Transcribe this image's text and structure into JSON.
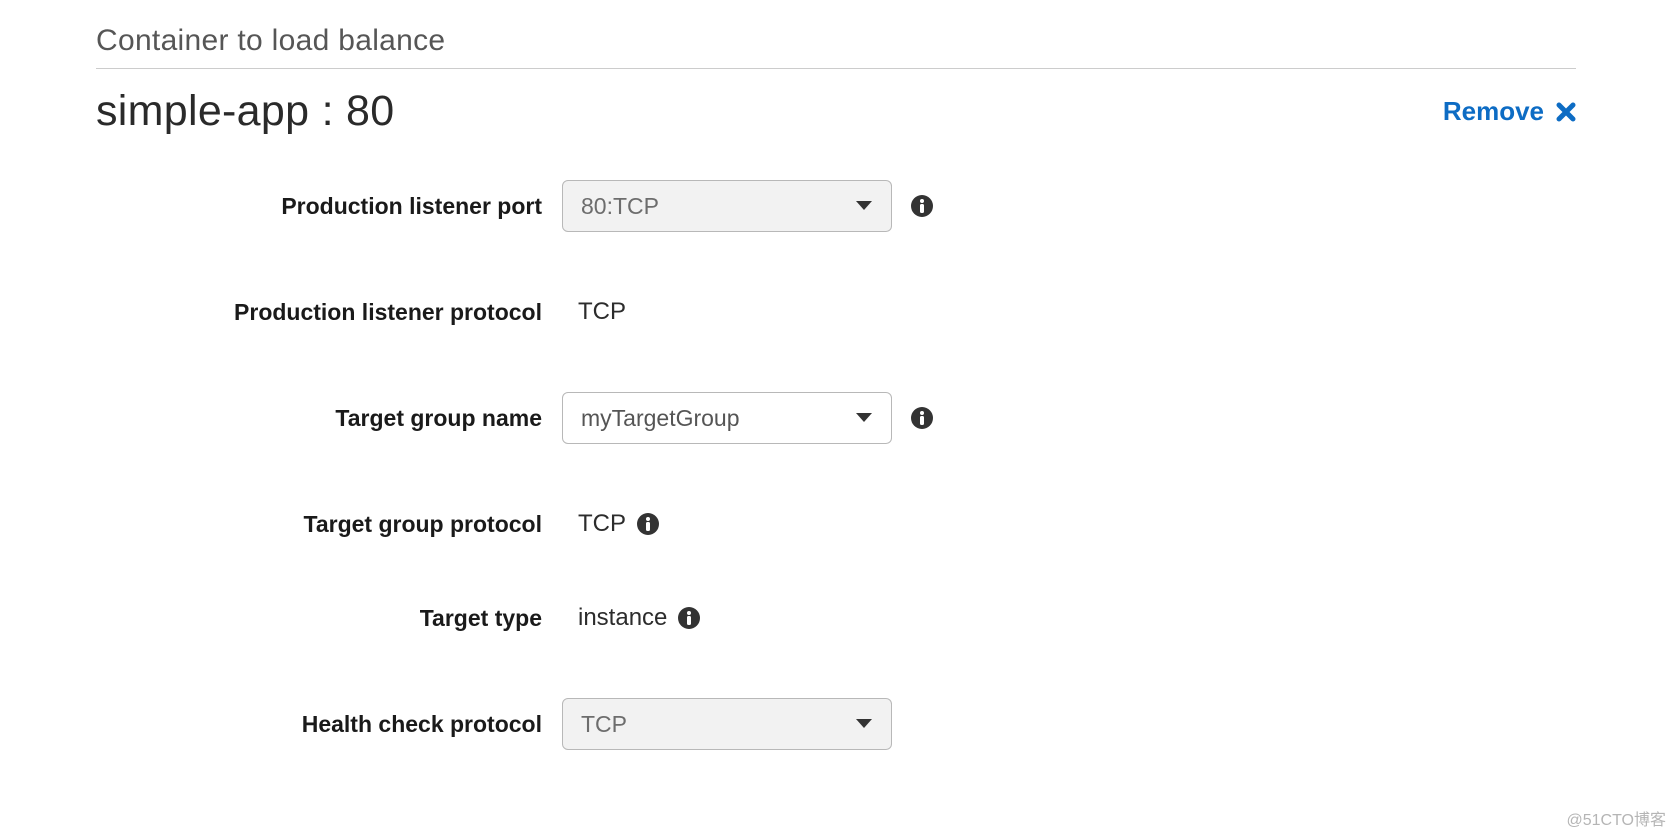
{
  "section": {
    "title": "Container to load balance"
  },
  "app": {
    "title": "simple-app : 80"
  },
  "remove": {
    "label": "Remove"
  },
  "fields": {
    "prod_listener_port": {
      "label": "Production listener port",
      "value": "80:TCP"
    },
    "prod_listener_protocol": {
      "label": "Production listener protocol",
      "value": "TCP"
    },
    "target_group_name": {
      "label": "Target group name",
      "value": "myTargetGroup"
    },
    "target_group_protocol": {
      "label": "Target group protocol",
      "value": "TCP"
    },
    "target_type": {
      "label": "Target type",
      "value": "instance"
    },
    "health_check_protocol": {
      "label": "Health check protocol",
      "value": "TCP"
    }
  },
  "watermark": "@51CTO博客"
}
